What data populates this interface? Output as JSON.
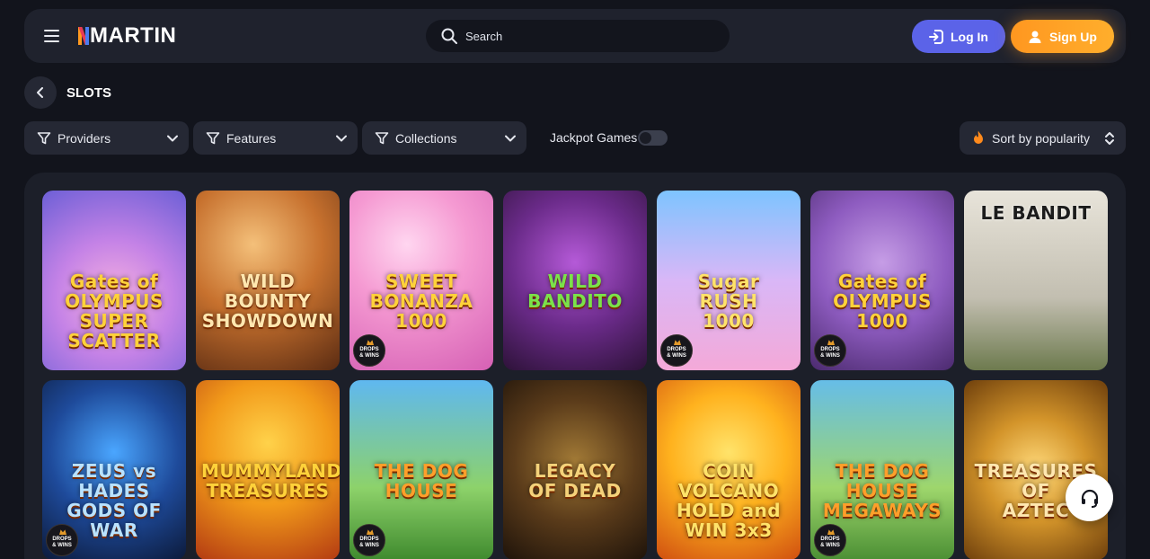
{
  "header": {
    "logo": "MARTIN",
    "search_placeholder": "Search",
    "login_label": "Log In",
    "signup_label": "Sign Up"
  },
  "page": {
    "title": "SLOTS"
  },
  "filters": {
    "providers": "Providers",
    "features": "Features",
    "collections": "Collections",
    "jackpot_label": "Jackpot Games",
    "jackpot_enabled": false,
    "sort_label": "Sort by popularity"
  },
  "games": [
    {
      "title": "Gates of\nOLYMPUS\nSUPER SCATTER",
      "badge": false
    },
    {
      "title": "WILD BOUNTY\nSHOWDOWN",
      "badge": false
    },
    {
      "title": "SWEET\nBONANZA\n1000",
      "badge": true
    },
    {
      "title": "WILD\nBANDITO",
      "badge": false
    },
    {
      "title": "Sugar\nRUSH\n1000",
      "badge": true
    },
    {
      "title": "Gates of\nOLYMPUS\n1000",
      "badge": true
    },
    {
      "title": "LE BANDIT",
      "badge": false
    },
    {
      "title": "ZEUS vs HADES\nGODS OF WAR",
      "badge": true
    },
    {
      "title": "MUMMYLAND\nTREASURES",
      "badge": false
    },
    {
      "title": "THE DOG\nHOUSE",
      "badge": true
    },
    {
      "title": "LEGACY\nOF DEAD",
      "badge": false
    },
    {
      "title": "COIN\nVOLCANO\nHOLD and WIN 3x3",
      "badge": false
    },
    {
      "title": "THE DOG\nHOUSE\nMEGAWAYS",
      "badge": true
    },
    {
      "title": "TREASURES OF\nAZTEC",
      "badge": false
    }
  ],
  "badge_text": "DROPS\n& WINS",
  "colors": {
    "background": "#12141c",
    "header": "#1f222d",
    "login": "#5b63e8",
    "signup": "#ffa126"
  },
  "icons": [
    "hamburger-icon",
    "search-icon",
    "login-icon",
    "user-icon",
    "chevron-left-icon",
    "filter-icon",
    "chevron-down-icon",
    "fire-icon",
    "sort-icon",
    "headset-icon"
  ]
}
